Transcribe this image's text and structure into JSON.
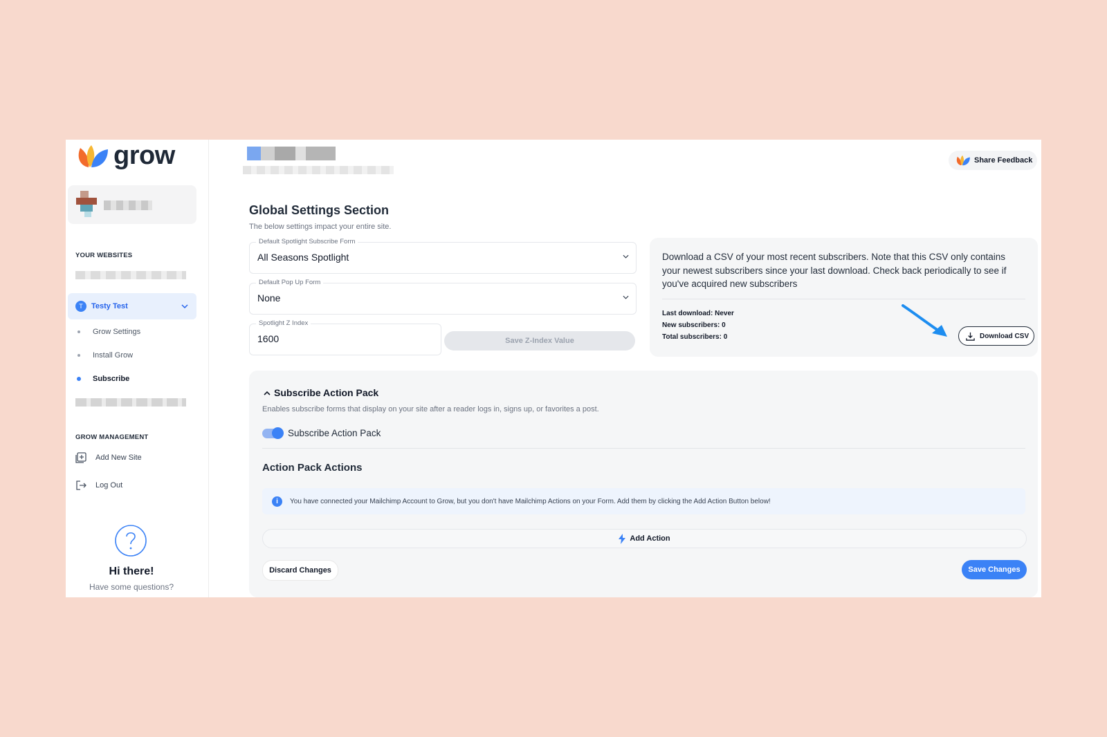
{
  "brand": {
    "name": "grow"
  },
  "header": {
    "share_feedback": "Share Feedback"
  },
  "sidebar": {
    "websites_label": "YOUR WEBSITES",
    "active_site": {
      "initial": "T",
      "name": "Testy Test"
    },
    "site_items": [
      {
        "label": "Grow Settings",
        "active": false
      },
      {
        "label": "Install Grow",
        "active": false
      },
      {
        "label": "Subscribe",
        "active": true
      }
    ],
    "management_label": "GROW MANAGEMENT",
    "management_items": [
      {
        "label": "Add New Site",
        "icon": "add-site-icon"
      },
      {
        "label": "Log Out",
        "icon": "logout-icon"
      }
    ],
    "help": {
      "title": "Hi there!",
      "subtitle": "Have some questions?"
    }
  },
  "global_settings": {
    "title": "Global Settings Section",
    "description": "The below settings impact your entire site.",
    "spotlight_form": {
      "label": "Default Spotlight Subscribe Form",
      "value": "All Seasons Spotlight"
    },
    "popup_form": {
      "label": "Default Pop Up Form",
      "value": "None"
    },
    "z_index": {
      "label": "Spotlight Z Index",
      "value": "1600"
    },
    "save_z_index": "Save Z-Index Value"
  },
  "csv": {
    "description": "Download a CSV of your most recent subscribers. Note that this CSV only contains your newest subscribers since your last download. Check back periodically to see if you've acquired new subscribers",
    "last_download": "Last download: Never",
    "new_subscribers": "New subscribers: 0",
    "total_subscribers": "Total subscribers: 0",
    "download_button": "Download CSV"
  },
  "action_pack": {
    "title": "Subscribe Action Pack",
    "description": "Enables subscribe forms that display on your site after a reader logs in, signs up, or favorites a post.",
    "toggle_label": "Subscribe Action Pack",
    "toggle_on": true,
    "actions_title": "Action Pack Actions",
    "info_message": "You have connected your Mailchimp Account to Grow, but you don't have Mailchimp Actions on your Form. Add them by clicking the Add Action Button below!",
    "add_action": "Add Action",
    "discard": "Discard Changes",
    "save": "Save Changes"
  },
  "colors": {
    "background": "#f8d9cd",
    "accent": "#3b82f6",
    "annotation_arrow": "#1d8df0"
  }
}
